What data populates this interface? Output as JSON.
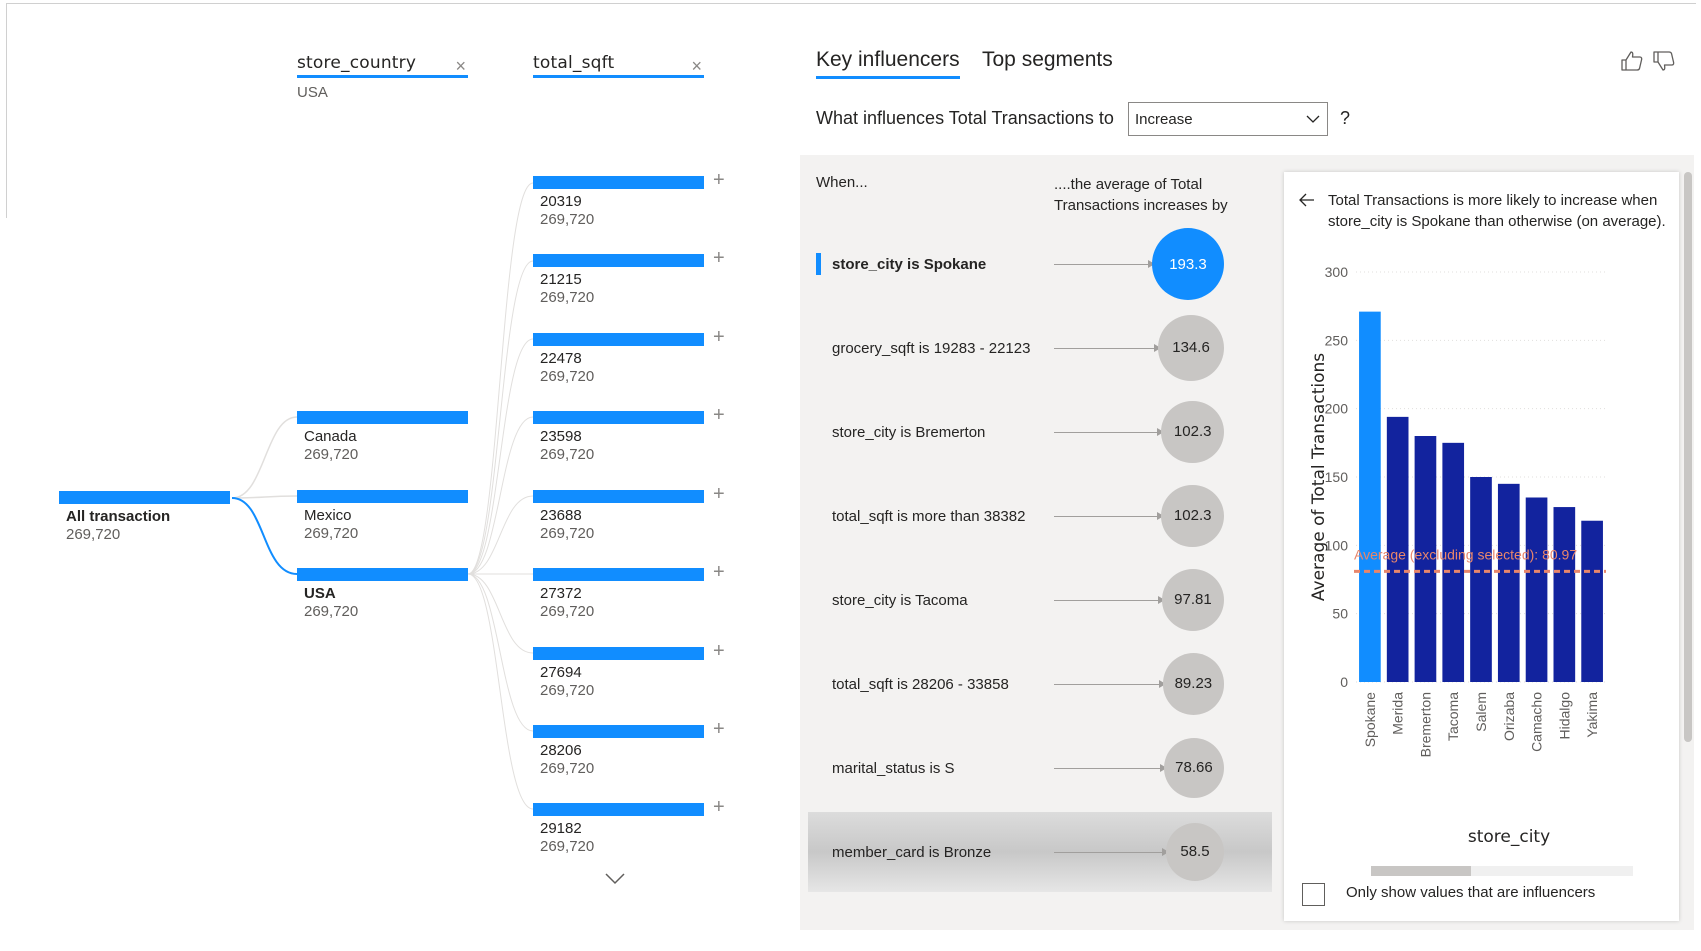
{
  "decomposition_tree": {
    "headers": [
      {
        "label": "store_country",
        "selected_value": "USA"
      },
      {
        "label": "total_sqft"
      }
    ],
    "root": {
      "label": "All transaction",
      "value": "269,720"
    },
    "level1": [
      {
        "label": "Canada",
        "value": "269,720"
      },
      {
        "label": "Mexico",
        "value": "269,720"
      },
      {
        "label": "USA",
        "value": "269,720"
      }
    ],
    "level2": [
      {
        "label": "20319",
        "value": "269,720"
      },
      {
        "label": "21215",
        "value": "269,720"
      },
      {
        "label": "22478",
        "value": "269,720"
      },
      {
        "label": "23598",
        "value": "269,720"
      },
      {
        "label": "23688",
        "value": "269,720"
      },
      {
        "label": "27372",
        "value": "269,720"
      },
      {
        "label": "27694",
        "value": "269,720"
      },
      {
        "label": "28206",
        "value": "269,720"
      },
      {
        "label": "29182",
        "value": "269,720"
      }
    ]
  },
  "key_influencers": {
    "tabs": [
      {
        "label": "Key influencers",
        "active": true
      },
      {
        "label": "Top segments",
        "active": false
      }
    ],
    "question_prefix": "What influences Total Transactions to",
    "dropdown_value": "Increase",
    "question_suffix": "?",
    "col_when": "When...",
    "col_effect": "....the average of Total Transactions increases by",
    "influencers": [
      {
        "label": "store_city is Spokane",
        "value": "193.3"
      },
      {
        "label": "grocery_sqft is 19283 - 22123",
        "value": "134.6"
      },
      {
        "label": "store_city is Bremerton",
        "value": "102.3"
      },
      {
        "label": "total_sqft is more than 38382",
        "value": "102.3"
      },
      {
        "label": "store_city is Tacoma",
        "value": "97.81"
      },
      {
        "label": "total_sqft is 28206 - 33858",
        "value": "89.23"
      },
      {
        "label": "marital_status is S",
        "value": "78.66"
      },
      {
        "label": "member_card is Bronze",
        "value": "58.5"
      }
    ],
    "detail_text": "Total Transactions is more likely to increase when store_city is Spokane than otherwise (on average).",
    "checkbox_label": "Only show values that are influencers"
  },
  "chart_data": {
    "type": "bar",
    "categories": [
      "Spokane",
      "Merida",
      "Bremerton",
      "Tacoma",
      "Salem",
      "Orizaba",
      "Camacho",
      "Hidalgo",
      "Yakima"
    ],
    "values": [
      271,
      194,
      180,
      175,
      150,
      145,
      135,
      128,
      118
    ],
    "highlighted": "Spokane",
    "xlabel": "store_city",
    "ylabel": "Average of Total Transactions",
    "ylim": [
      0,
      300
    ],
    "yticks": [
      0,
      50,
      100,
      150,
      200,
      250,
      300
    ],
    "reference_line": {
      "label": "Average (excluding selected): 80.97",
      "value": 80.97
    },
    "colors": {
      "highlight": "#118dff",
      "bar": "#12239e",
      "reference": "#e8866b"
    },
    "grid": true
  }
}
